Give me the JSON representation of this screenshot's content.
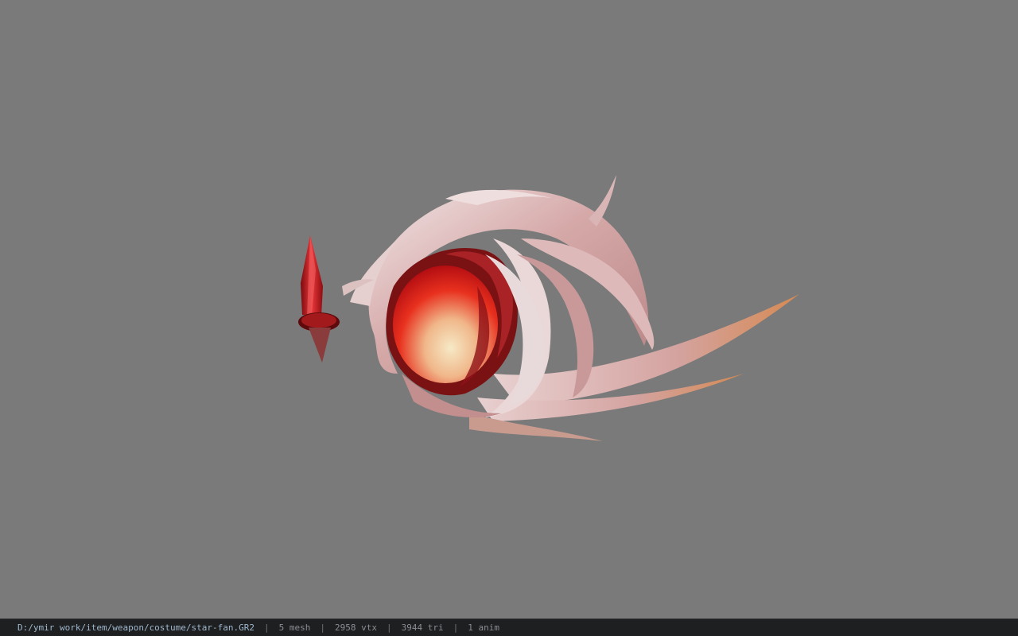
{
  "viewer": {
    "background_color": "#7a7a7a",
    "model_name": "star-fan",
    "model_colors": {
      "shell": "#d9b3b3",
      "orb_core": "#e82a1a",
      "orb_glow": "#f4e2b8",
      "crystal": "#c0161a",
      "blade_tip": "#d8935a"
    }
  },
  "statusbar": {
    "file_path": "D:/ymir work/item/weapon/costume/star-fan.GR2",
    "separator": "|",
    "mesh_count": "5 mesh",
    "vertex_count": "2958 vtx",
    "triangle_count": "3944 tri",
    "animation_count": "1 anim"
  }
}
